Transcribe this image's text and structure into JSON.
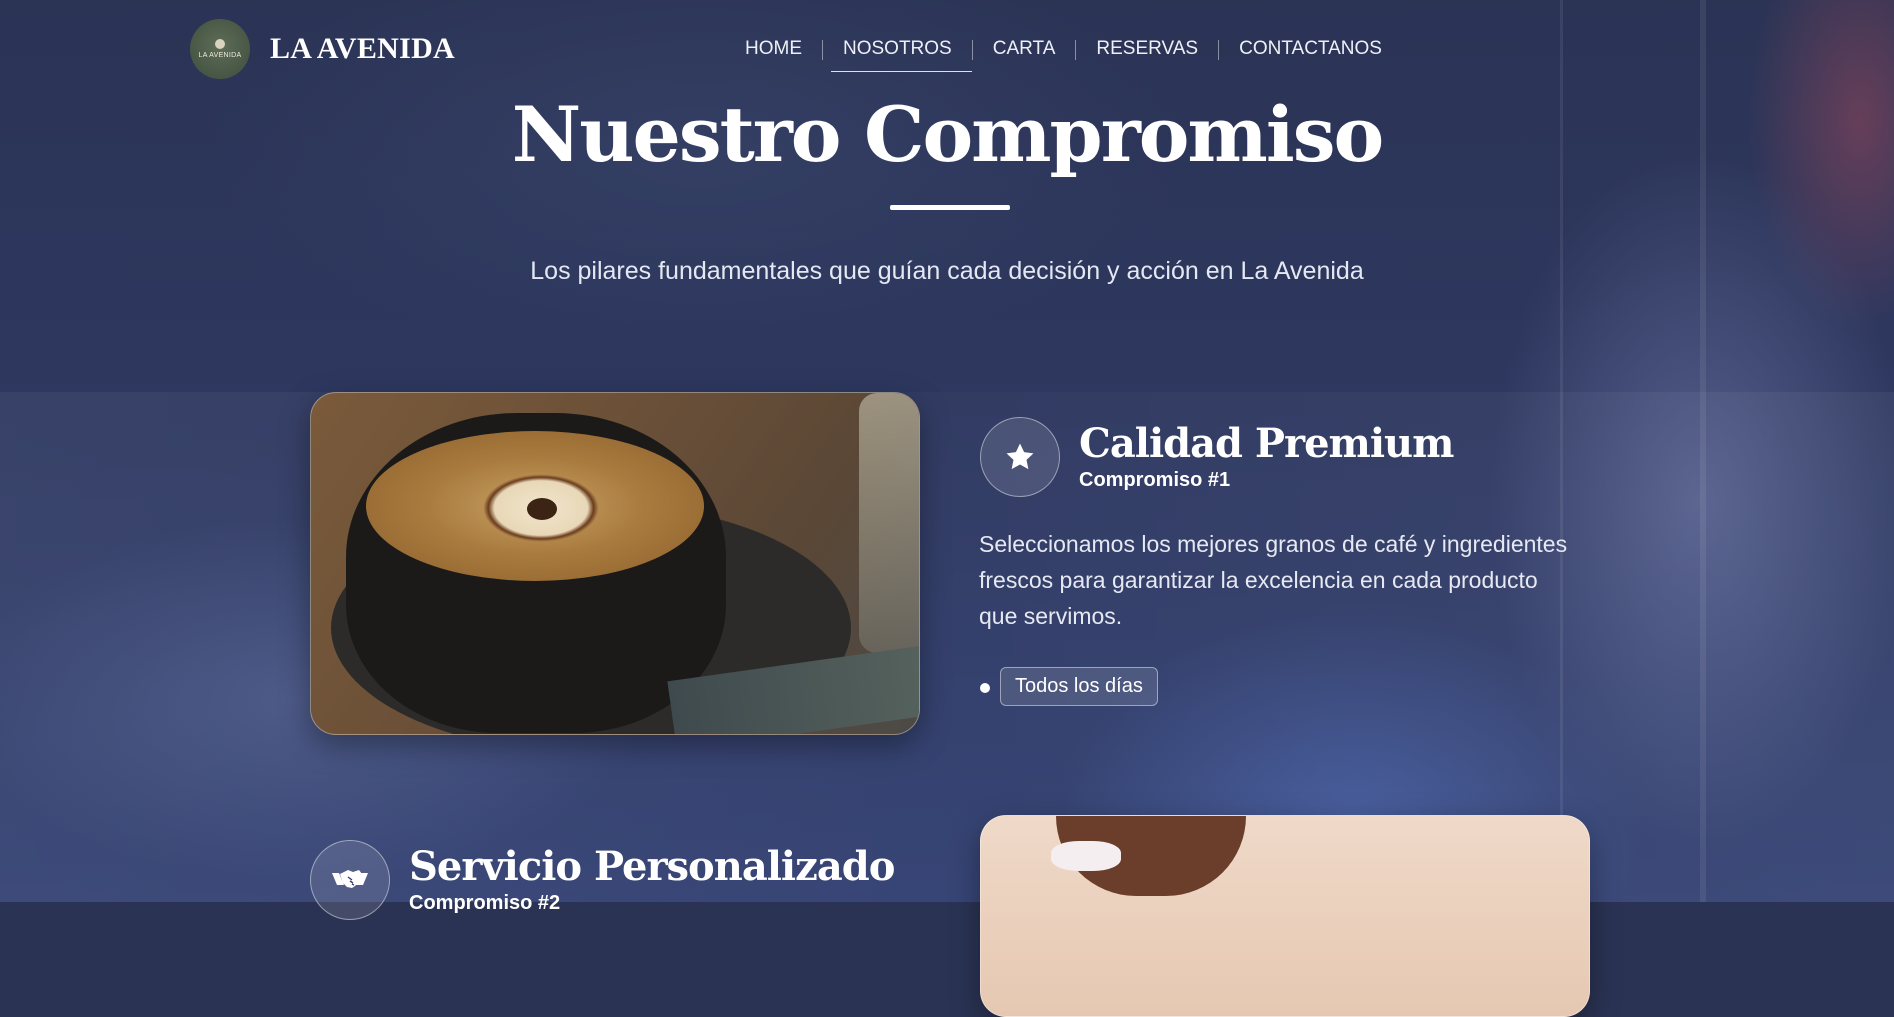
{
  "header": {
    "logo_text": "LA AVENIDA",
    "brand": "LA AVENIDA",
    "nav": [
      "HOME",
      "NOSOTROS",
      "CARTA",
      "RESERVAS",
      "CONTACTANOS"
    ],
    "active_nav": "NOSOTROS"
  },
  "hero": {
    "title": "Nuestro Compromiso",
    "subtitle": "Los pilares fundamentales que guían cada decisión y acción en La Avenida"
  },
  "features": [
    {
      "icon": "star-icon",
      "title": "Calidad Premium",
      "kicker": "Compromiso #1",
      "description": "Seleccionamos los mejores granos de café y ingredientes frescos para garantizar la excelencia en cada producto que servimos.",
      "tag": "Todos los días",
      "image": "coffee-latte-art-photo"
    },
    {
      "icon": "handshake-icon",
      "title": "Servicio Personalizado",
      "kicker": "Compromiso #2",
      "image": "barista-photo"
    }
  ],
  "colors": {
    "background": "#2a3354",
    "logo_green": "#4a5a47",
    "text": "#ffffff"
  }
}
